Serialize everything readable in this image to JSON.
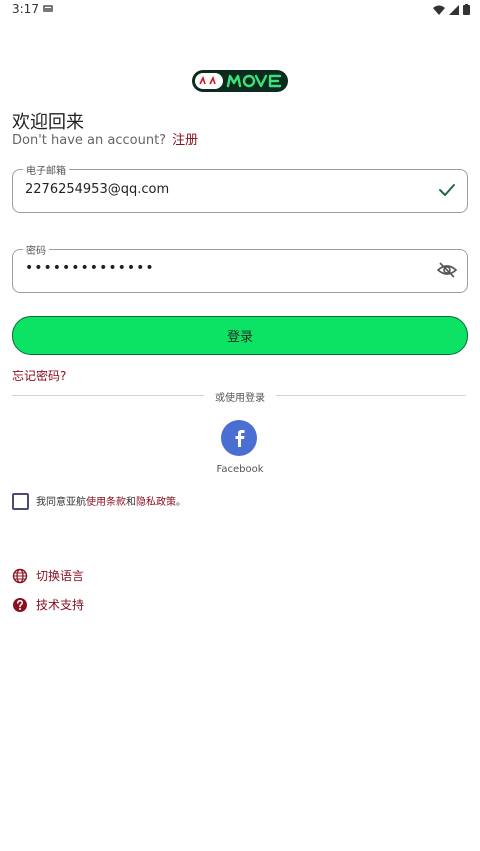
{
  "status": {
    "time": "3:17"
  },
  "header": {
    "welcome": "欢迎回来",
    "no_account_text": "Don't have an account?",
    "signup_label": "注册"
  },
  "form": {
    "email_label": "电子邮箱",
    "email_value": "2276254953@qq.com",
    "password_label": "密码",
    "password_value": "••••••••••••••",
    "login_label": "登录",
    "forgot_label": "忘记密码?"
  },
  "social": {
    "divider_text": "或使用登录",
    "facebook_label": "Facebook"
  },
  "terms": {
    "prefix": "我同意亚航",
    "terms_link": "使用条款",
    "and": "和",
    "privacy_link": "隐私政策",
    "suffix": "。"
  },
  "footer": {
    "language_label": "切换语言",
    "support_label": "技术支持"
  },
  "colors": {
    "accent": "#8a1020",
    "button": "#0ce264",
    "facebook": "#4a6ed1"
  },
  "icons": [
    "wifi-icon",
    "signal-icon",
    "battery-icon",
    "check-icon",
    "eye-off-icon",
    "facebook-icon",
    "globe-icon",
    "help-icon"
  ]
}
